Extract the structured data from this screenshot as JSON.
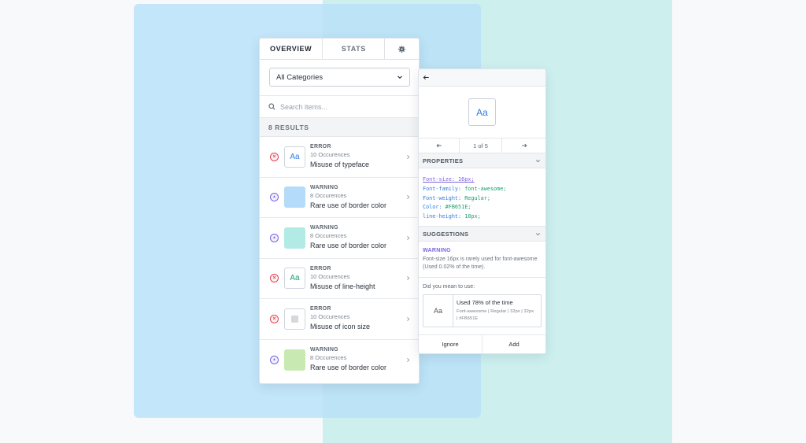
{
  "tabs": {
    "overview": "OVERVIEW",
    "stats": "STATS"
  },
  "filter": {
    "selected": "All Categories"
  },
  "search": {
    "placeholder": "Search items..."
  },
  "results": {
    "heading": "8 RESULTS"
  },
  "items": [
    {
      "severity": "error",
      "kind": "ERROR",
      "count": "10 Occurences",
      "title": "Misuse of typeface",
      "thumb": "Aa",
      "thumb_color": "#2f7de1"
    },
    {
      "severity": "warning",
      "kind": "WARNING",
      "count": "8 Occurences",
      "title": "Rare use of border color",
      "swatch": "#b4dcfa"
    },
    {
      "severity": "warning",
      "kind": "WARNING",
      "count": "8 Occurences",
      "title": "Rare use of border color",
      "swatch": "#b2ebe6"
    },
    {
      "severity": "error",
      "kind": "ERROR",
      "count": "10 Occurences",
      "title": "Misuse of line-height",
      "thumb": "Aa",
      "thumb_color": "#18a06c"
    },
    {
      "severity": "error",
      "kind": "ERROR",
      "count": "10 Occurences",
      "title": "Misuse of icon size",
      "thumb_icon": "square-icon"
    },
    {
      "severity": "warning",
      "kind": "WARNING",
      "count": "8 Occurences",
      "title": "Rare use of border color",
      "swatch": "#c8eab2"
    }
  ],
  "detail": {
    "preview": "Aa",
    "pager": "1 of 5",
    "properties_heading": "PROPERTIES",
    "properties": [
      {
        "key": "Font-size:",
        "value": "16px;"
      },
      {
        "key": "Font-family:",
        "value": "font-awesome;"
      },
      {
        "key": "Font-weight:",
        "value": "Regular;"
      },
      {
        "key": "Color:",
        "value": "#FB651E;"
      },
      {
        "key": "line-height:",
        "value": "18px;"
      }
    ],
    "suggestions_heading": "SUGGESTIONS",
    "suggestion_kind": "WARNING",
    "suggestion_text": "Font-size 16px is rarely used for font-awesome (Used 0.02% of the time).",
    "mean_question": "Did you mean to use:",
    "card_sample": "Aa",
    "card_usage": "Used 78% of the time",
    "card_detail": "Font-awesome | Regular | 32px | 32px | #FB651E",
    "ignore": "Ignore",
    "add": "Add"
  },
  "colors": {
    "error": "#e0424f",
    "warning": "#7b63e0",
    "accent": "#2f7de1"
  }
}
